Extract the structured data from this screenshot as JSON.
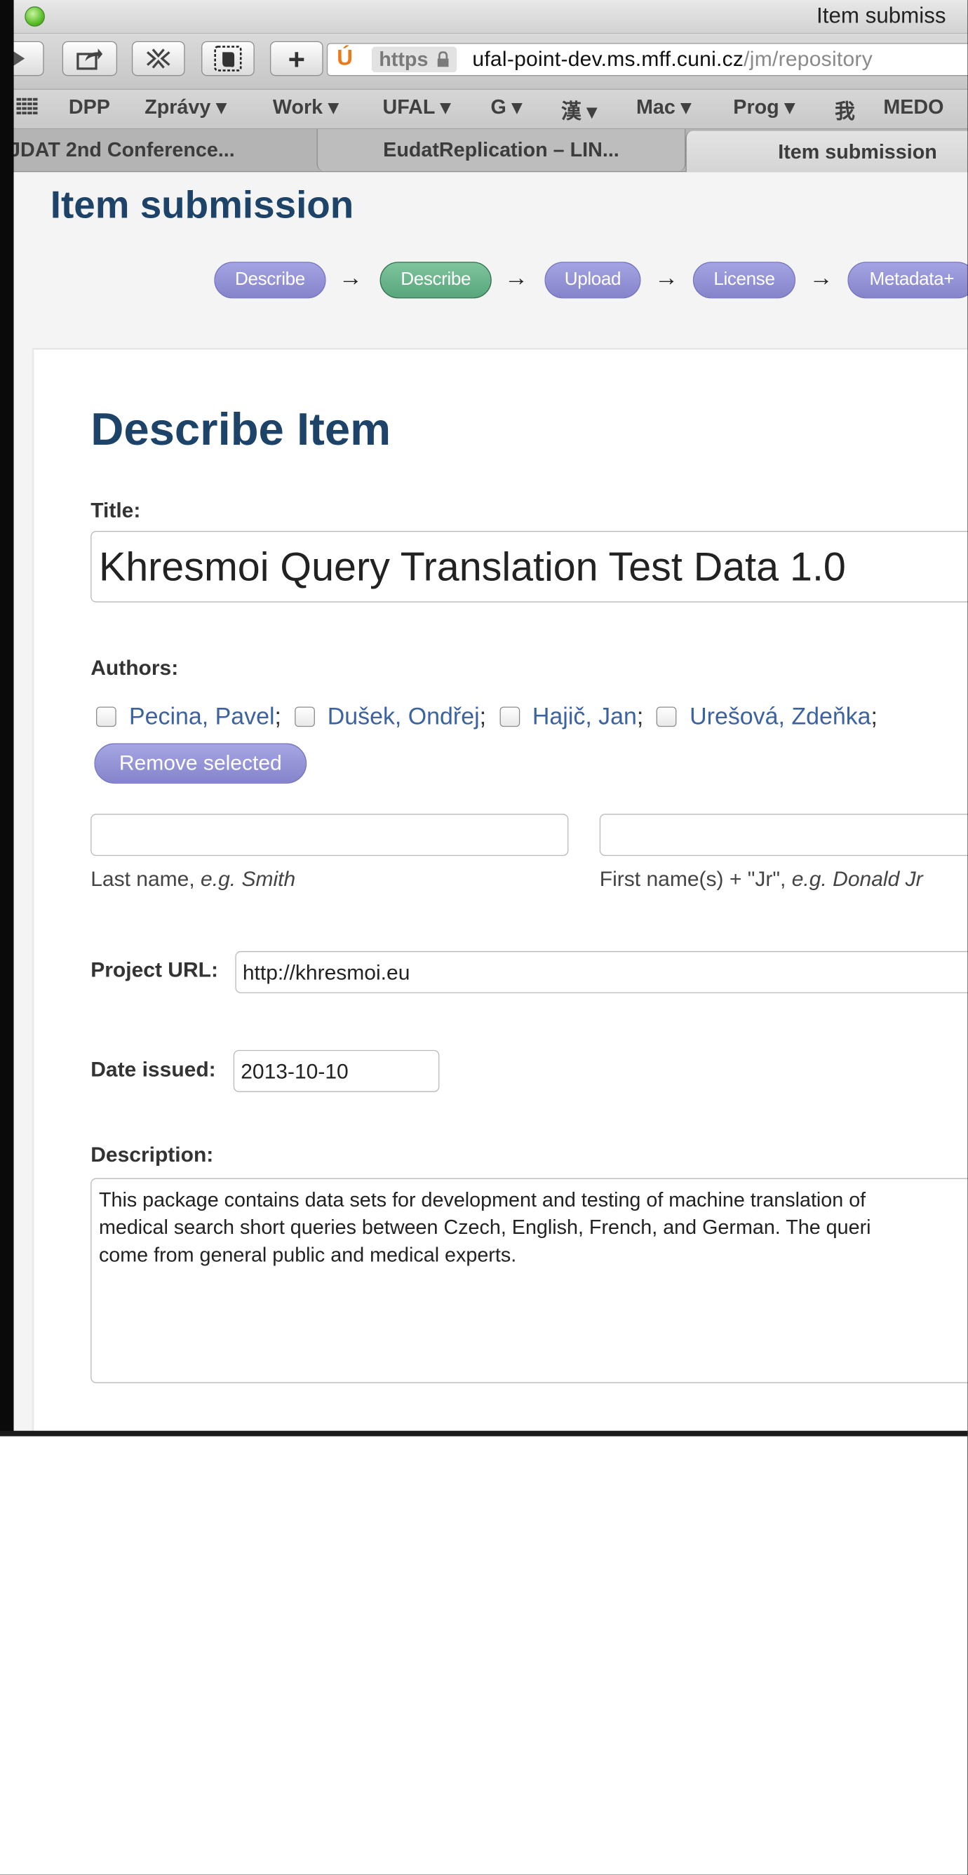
{
  "window": {
    "title": "Item submiss"
  },
  "toolbar": {
    "url_scheme": "https",
    "url_host": "ufal-point-dev.ms.mff.cuni.cz",
    "url_path": "/jm/repository",
    "plus_label": "+",
    "favicon": "Ú"
  },
  "bookmarks": [
    "DPP",
    "Zprávy ▾",
    "Work ▾",
    "UFAL ▾",
    "G ▾",
    "漢 ▾",
    "Mac ▾",
    "Prog ▾",
    "我",
    "MEDO"
  ],
  "tabs": [
    {
      "label": "JDAT 2nd Conference..."
    },
    {
      "label": "EudatReplication – LIN..."
    },
    {
      "label": "Item submission"
    }
  ],
  "page": {
    "title": "Item submission",
    "trail": [
      "Describe",
      "Describe",
      "Upload",
      "License",
      "Metadata+"
    ],
    "trail_arrow": "→"
  },
  "form": {
    "heading": "Describe Item",
    "title_label": "Title:",
    "title_value": "Khresmoi Query Translation Test Data 1.0",
    "authors_label": "Authors:",
    "authors": [
      "Pecina, Pavel",
      "Dušek, Ondřej",
      "Hajič, Jan",
      "Urešová, Zdeňka"
    ],
    "author_separator": ";",
    "remove_selected": "Remove selected",
    "last_name_hint_prefix": "Last name, ",
    "last_name_hint_example": "e.g. Smith",
    "first_name_hint_prefix": "First name(s) + \"Jr\", ",
    "first_name_hint_example": "e.g. Donald Jr",
    "project_url_label": "Project URL:",
    "project_url_value": "http://khresmoi.eu",
    "date_issued_label": "Date issued:",
    "date_issued_value": "2013-10-10",
    "description_label": "Description:",
    "description_lines": [
      "This package contains data sets for development and testing of machine translation of",
      "medical search short queries between Czech, English, French, and German. The queri",
      "come from general public and medical experts."
    ]
  }
}
